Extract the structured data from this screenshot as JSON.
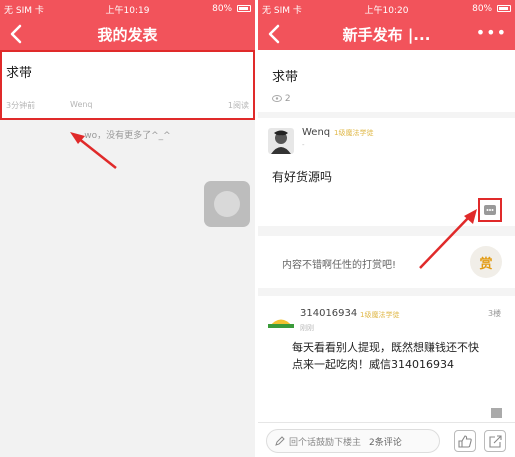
{
  "left_screen": {
    "statusbar": {
      "carrier": "无 SIM 卡",
      "time": "上午10:19",
      "battery": "80%"
    },
    "nav": {
      "title": "我的发表"
    },
    "post": {
      "title": "求带",
      "time": "3分钟前",
      "author": "Wenq",
      "reads": "1阅读"
    },
    "no_more_text": "wo，没有更多了^_^"
  },
  "right_screen": {
    "statusbar": {
      "carrier": "无 SIM 卡",
      "time": "上午10:20",
      "battery": "80%"
    },
    "nav": {
      "title": "新手发布 |..."
    },
    "post": {
      "title": "求带",
      "views": "2"
    },
    "reply": {
      "user": "Wenq",
      "level": "1级魔法学徒",
      "subtime": "-",
      "content": "有好货源吗"
    },
    "reward": {
      "text": "内容不错啊任性的打赏吧!",
      "button": "赏"
    },
    "comment": {
      "user": "314016934",
      "level": "1级魔法学徒",
      "time": "刚刚",
      "floor": "3楼",
      "content": "每天看看别人提现，既然想赚钱还不快点来一起吃肉！威信314016934"
    },
    "bottom": {
      "placeholder": "回个话鼓励下楼主",
      "comment_count": "2条评论"
    }
  },
  "colors": {
    "header": "#f2535b",
    "highlight": "#e02a2a",
    "reward": "#e39b12"
  }
}
